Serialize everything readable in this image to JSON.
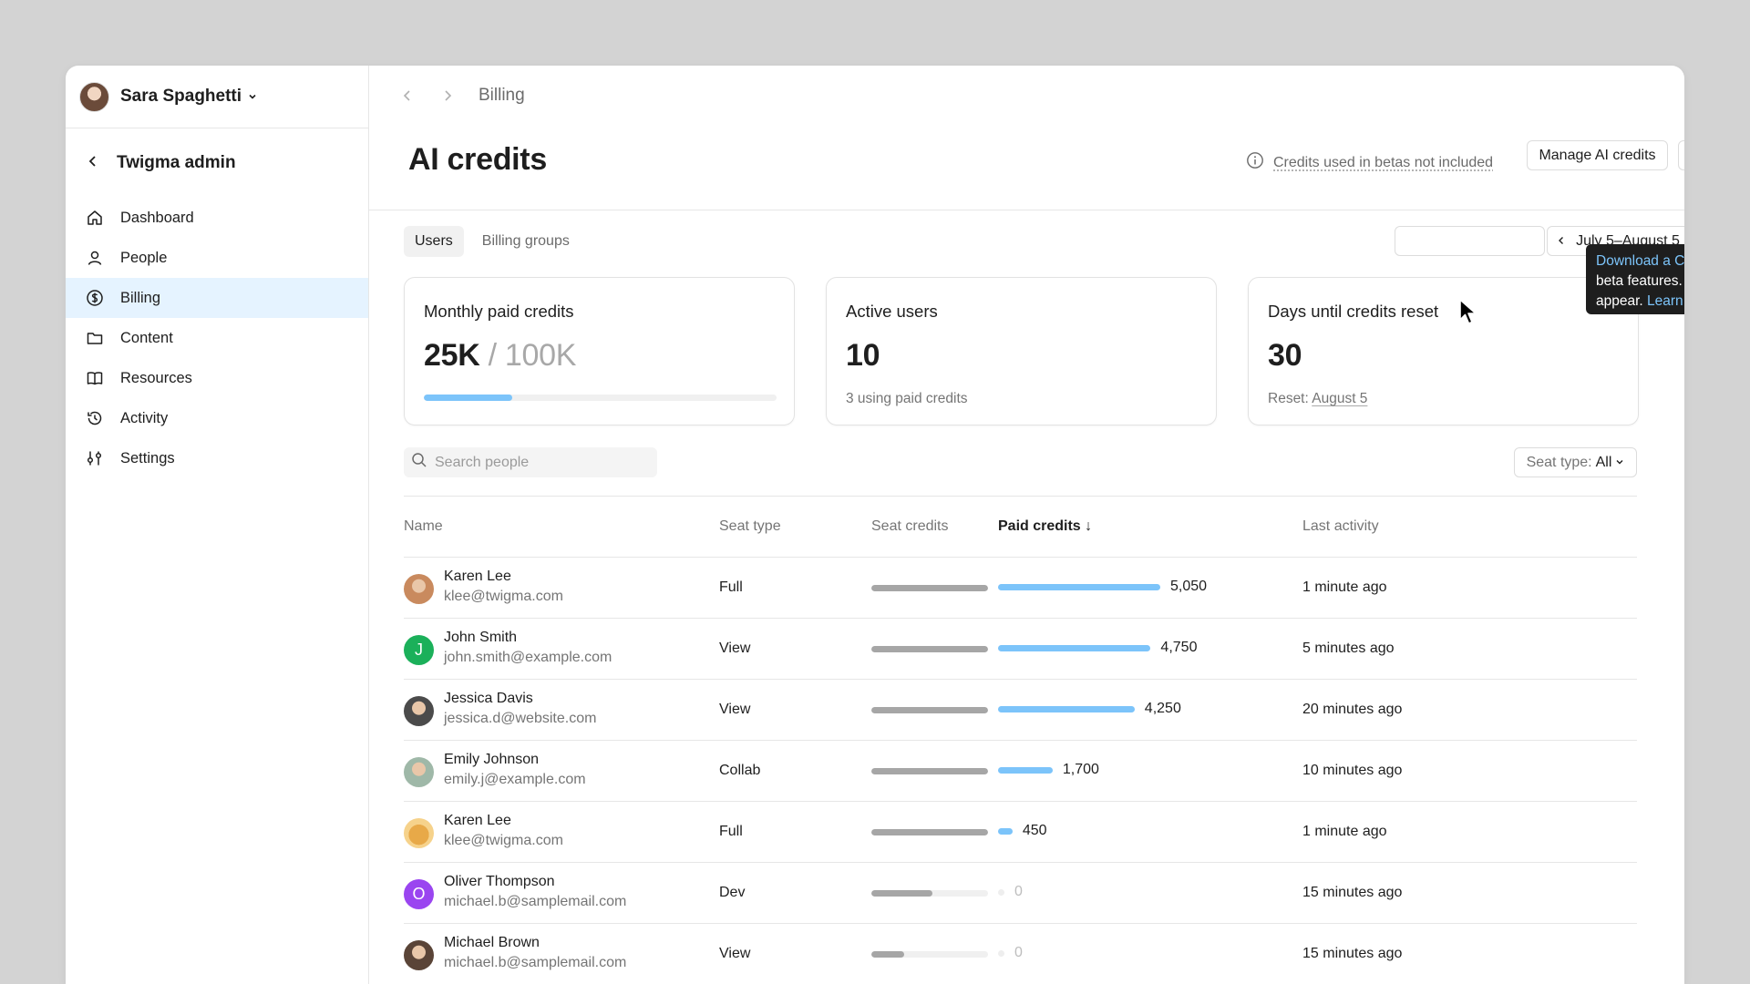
{
  "sidebar": {
    "user_name": "Sara Spaghetti",
    "org_title": "Twigma admin",
    "items": [
      {
        "label": "Dashboard",
        "icon": "home-icon"
      },
      {
        "label": "People",
        "icon": "person-icon"
      },
      {
        "label": "Billing",
        "icon": "dollar-circle-icon",
        "active": true
      },
      {
        "label": "Content",
        "icon": "folder-icon"
      },
      {
        "label": "Resources",
        "icon": "book-icon"
      },
      {
        "label": "Activity",
        "icon": "history-icon"
      },
      {
        "label": "Settings",
        "icon": "sliders-icon"
      }
    ]
  },
  "topbar": {
    "breadcrumb": "Billing"
  },
  "header": {
    "title": "AI credits",
    "beta_note": "Credits used in betas not included",
    "manage_label": "Manage AI credits"
  },
  "tooltip": {
    "link1": "Download a CSV",
    "text": " for credit use in beta features. Earlier usage may not appear. ",
    "link2": "Learn more"
  },
  "tabs": [
    {
      "label": "Users",
      "active": true
    },
    {
      "label": "Billing groups",
      "active": false
    }
  ],
  "date_range": "July 5–August 5",
  "cards": {
    "monthly": {
      "title": "Monthly paid credits",
      "value": "25K",
      "total": "/ 100K",
      "progress": 0.25
    },
    "active": {
      "title": "Active users",
      "value": "10",
      "sub": "3 using paid credits"
    },
    "reset": {
      "title": "Days until credits reset",
      "value": "30",
      "sub_label": "Reset: ",
      "sub_link": "August 5"
    }
  },
  "search": {
    "placeholder": "Search people"
  },
  "seat_filter": {
    "label": "Seat type:",
    "value": "All"
  },
  "table": {
    "headers": {
      "name": "Name",
      "seat_type": "Seat type",
      "seat_credits": "Seat credits",
      "paid_credits": "Paid credits",
      "last_activity": "Last activity"
    },
    "rows": [
      {
        "name": "Karen Lee",
        "email": "klee@twigma.com",
        "seat": "Full",
        "seat_fill": 1.0,
        "paid": "5,050",
        "paid_value": 5050,
        "last": "1 minute ago",
        "avatar": "photo",
        "color": "#c98a5e"
      },
      {
        "name": "John Smith",
        "email": "john.smith@example.com",
        "seat": "View",
        "seat_fill": 1.0,
        "paid": "4,750",
        "paid_value": 4750,
        "last": "5 minutes ago",
        "avatar": "J",
        "color": "#1bb05a"
      },
      {
        "name": "Jessica Davis",
        "email": "jessica.d@website.com",
        "seat": "View",
        "seat_fill": 1.0,
        "paid": "4,250",
        "paid_value": 4250,
        "last": "20 minutes ago",
        "avatar": "photo",
        "color": "#4b4b4b"
      },
      {
        "name": "Emily Johnson",
        "email": "emily.j@example.com",
        "seat": "Collab",
        "seat_fill": 1.0,
        "paid": "1,700",
        "paid_value": 1700,
        "last": "10 minutes ago",
        "avatar": "photo",
        "color": "#9fb8a8"
      },
      {
        "name": "Karen Lee",
        "email": "klee@twigma.com",
        "seat": "Full",
        "seat_fill": 1.0,
        "paid": "450",
        "paid_value": 450,
        "last": "1 minute ago",
        "avatar": "dog",
        "color": "#f6d28b"
      },
      {
        "name": "Oliver Thompson",
        "email": "michael.b@samplemail.com",
        "seat": "Dev",
        "seat_fill": 0.52,
        "paid": "0",
        "paid_value": 0,
        "last": "15 minutes ago",
        "avatar": "O",
        "color": "#9a45f0"
      },
      {
        "name": "Michael Brown",
        "email": "michael.b@samplemail.com",
        "seat": "View",
        "seat_fill": 0.28,
        "paid": "0",
        "paid_value": 0,
        "last": "15 minutes ago",
        "avatar": "photo",
        "color": "#5a4437"
      }
    ]
  },
  "colors": {
    "accent": "#7cc4fa",
    "active_nav": "#e5f3ff",
    "seat_bar": "#a6a6a6"
  }
}
